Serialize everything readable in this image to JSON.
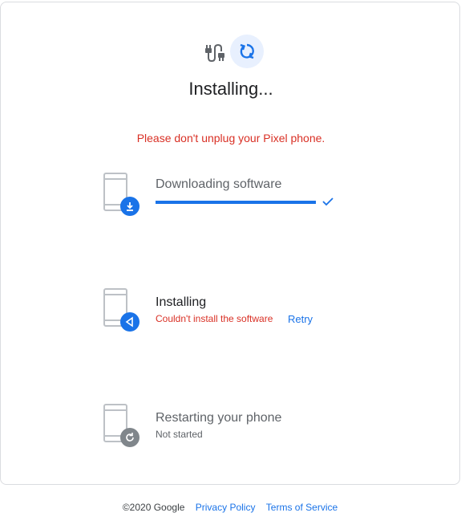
{
  "header": {
    "title": "Installing..."
  },
  "warning": "Please don't unplug your Pixel phone.",
  "steps": [
    {
      "title": "Downloading software",
      "progress": 1.0,
      "status": "complete"
    },
    {
      "title": "Installing",
      "subtitle": "Couldn't install the software",
      "action_label": "Retry",
      "status": "error"
    },
    {
      "title": "Restarting your phone",
      "subtitle": "Not started",
      "status": "not-started"
    }
  ],
  "footer": {
    "copyright": "©2020 Google",
    "privacy_label": "Privacy Policy",
    "terms_label": "Terms of Service"
  },
  "colors": {
    "accent": "#1a73e8",
    "error": "#d93025",
    "text": "#202124",
    "muted": "#5f6368"
  },
  "icons": {
    "connection": "cable-icon",
    "sync": "sync-icon",
    "download": "download-icon",
    "install": "install-icon",
    "restart": "restart-icon",
    "check": "check-icon"
  }
}
